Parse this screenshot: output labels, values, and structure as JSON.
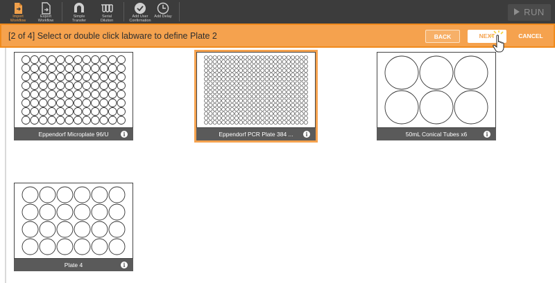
{
  "toolbar": {
    "tools": [
      {
        "label": "Import\nWorkflow",
        "icon": "import-workflow-icon",
        "active": true
      },
      {
        "label": "Export\nWorkflow",
        "icon": "export-workflow-icon",
        "active": false
      },
      {
        "label": "Simple\nTransfer",
        "icon": "simple-transfer-icon",
        "active": false
      },
      {
        "label": "Serial\nDilution",
        "icon": "serial-dilution-icon",
        "active": false
      },
      {
        "label": "Add User\nConfirmation",
        "icon": "checkmark-circle-icon",
        "active": false
      },
      {
        "label": "Add Delay",
        "icon": "clock-icon",
        "active": false
      }
    ],
    "run_label": "RUN"
  },
  "banner": {
    "message": "[2 of 4] Select or double click labware to define Plate 2",
    "back_label": "BACK",
    "next_label": "NEXT",
    "cancel_label": "CANCEL"
  },
  "labware": [
    {
      "name": "Eppendorf Microplate 96/U",
      "rows": 8,
      "cols": 12,
      "selected": false
    },
    {
      "name": "Eppendorf PCR Plate 384 ...",
      "rows": 16,
      "cols": 24,
      "selected": true
    },
    {
      "name": "50mL Conical Tubes x6",
      "rows": 2,
      "cols": 3,
      "selected": false
    },
    {
      "name": "Plate 4",
      "rows": 4,
      "cols": 6,
      "selected": false
    }
  ],
  "colors": {
    "accent": "#f5a24e",
    "toolbar": "#3c3c3c",
    "caption": "#5a5a5a"
  }
}
